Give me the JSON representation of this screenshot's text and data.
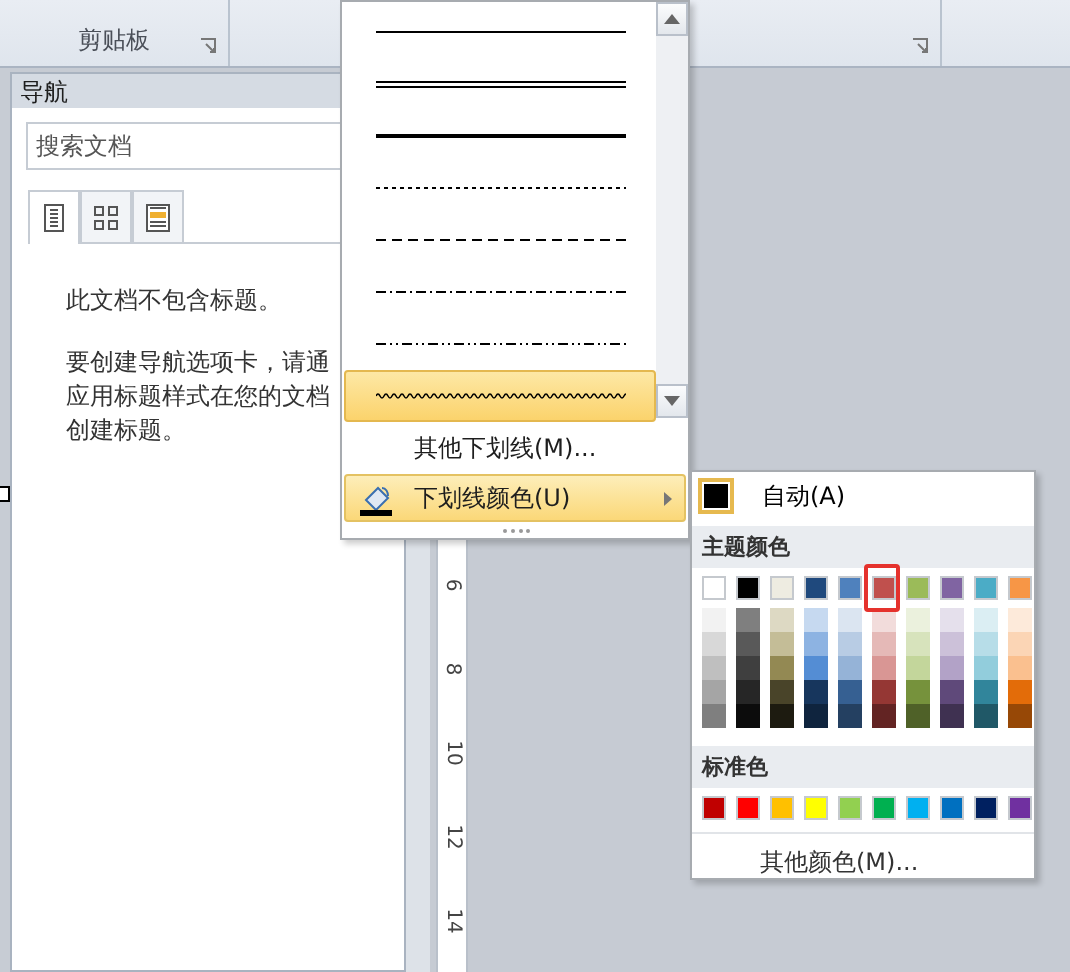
{
  "ribbon": {
    "groups": [
      {
        "label": "剪贴板"
      }
    ]
  },
  "navigation": {
    "title": "导航",
    "search": {
      "placeholder": "搜索文档"
    },
    "tabs": [
      {
        "kind": "headings",
        "selected": true
      },
      {
        "kind": "pages",
        "selected": false
      },
      {
        "kind": "results",
        "selected": false
      }
    ],
    "messages": [
      {
        "lines": [
          "此文档不包含标题。"
        ]
      },
      {
        "lines": [
          "要创建导航选项卡，请通",
          "应用标题样式在您的文档",
          "创建标题。"
        ]
      }
    ]
  },
  "ruler": {
    "labels": [
      "6",
      "8",
      "10",
      "12",
      "14"
    ]
  },
  "underline_menu": {
    "styles": [
      {
        "kind": "single",
        "selected": false
      },
      {
        "kind": "double",
        "selected": false
      },
      {
        "kind": "thick",
        "selected": false
      },
      {
        "kind": "dotted",
        "selected": false
      },
      {
        "kind": "dashed",
        "selected": false
      },
      {
        "kind": "dash-dot",
        "selected": false
      },
      {
        "kind": "dash-dot-dot",
        "selected": false
      },
      {
        "kind": "wavy",
        "selected": true
      }
    ],
    "items": [
      {
        "label": "其他下划线(M)...",
        "selected": false,
        "submenu": false
      },
      {
        "label": "下划线颜色(U)",
        "selected": true,
        "submenu": true
      }
    ]
  },
  "color_menu": {
    "automatic": {
      "label": "自动(A)",
      "color": "#000000"
    },
    "theme_title": "主题颜色",
    "theme_colors": [
      {
        "color": "#ffffff",
        "highlighted": false,
        "shades": [
          {
            "color": "#f2f2f2"
          },
          {
            "color": "#d8d8d8"
          },
          {
            "color": "#bfbfbf"
          },
          {
            "color": "#a5a5a5"
          },
          {
            "color": "#7f7f7f"
          }
        ]
      },
      {
        "color": "#000000",
        "highlighted": false,
        "shades": [
          {
            "color": "#7f7f7f"
          },
          {
            "color": "#595959"
          },
          {
            "color": "#3f3f3f"
          },
          {
            "color": "#262626"
          },
          {
            "color": "#0c0c0c"
          }
        ]
      },
      {
        "color": "#eeece1",
        "highlighted": false,
        "shades": [
          {
            "color": "#ddd9c3"
          },
          {
            "color": "#c4bd97"
          },
          {
            "color": "#938953"
          },
          {
            "color": "#494429"
          },
          {
            "color": "#1d1b10"
          }
        ]
      },
      {
        "color": "#1f497d",
        "highlighted": false,
        "shades": [
          {
            "color": "#c6d9f0"
          },
          {
            "color": "#8db3e2"
          },
          {
            "color": "#548dd4"
          },
          {
            "color": "#17365d"
          },
          {
            "color": "#0f243e"
          }
        ]
      },
      {
        "color": "#4f81bd",
        "highlighted": false,
        "shades": [
          {
            "color": "#dbe5f1"
          },
          {
            "color": "#b8cce4"
          },
          {
            "color": "#95b3d7"
          },
          {
            "color": "#366092"
          },
          {
            "color": "#244061"
          }
        ]
      },
      {
        "color": "#c0504d",
        "highlighted": true,
        "shades": [
          {
            "color": "#f2dcdb"
          },
          {
            "color": "#e5b9b7"
          },
          {
            "color": "#d99694"
          },
          {
            "color": "#953734"
          },
          {
            "color": "#632423"
          }
        ]
      },
      {
        "color": "#9bbb59",
        "highlighted": false,
        "shades": [
          {
            "color": "#ebf1dd"
          },
          {
            "color": "#d7e3bc"
          },
          {
            "color": "#c3d69b"
          },
          {
            "color": "#76923c"
          },
          {
            "color": "#4f6128"
          }
        ]
      },
      {
        "color": "#8064a2",
        "highlighted": false,
        "shades": [
          {
            "color": "#e5e0ec"
          },
          {
            "color": "#ccc1d9"
          },
          {
            "color": "#b2a2c7"
          },
          {
            "color": "#5f497a"
          },
          {
            "color": "#3f3151"
          }
        ]
      },
      {
        "color": "#4bacc6",
        "highlighted": false,
        "shades": [
          {
            "color": "#dbeef3"
          },
          {
            "color": "#b7dde8"
          },
          {
            "color": "#92cddc"
          },
          {
            "color": "#31859b"
          },
          {
            "color": "#205867"
          }
        ]
      },
      {
        "color": "#f79646",
        "highlighted": false,
        "shades": [
          {
            "color": "#fdeada"
          },
          {
            "color": "#fbd5b5"
          },
          {
            "color": "#fac08f"
          },
          {
            "color": "#e36c09"
          },
          {
            "color": "#974806"
          }
        ]
      }
    ],
    "standard_title": "标准色",
    "standard_colors": [
      {
        "color": "#c00000"
      },
      {
        "color": "#ff0000"
      },
      {
        "color": "#ffc000"
      },
      {
        "color": "#ffff00"
      },
      {
        "color": "#92d050"
      },
      {
        "color": "#00b050"
      },
      {
        "color": "#00b0f0"
      },
      {
        "color": "#0070c0"
      },
      {
        "color": "#002060"
      },
      {
        "color": "#7030a0"
      }
    ],
    "more_label": "其他颜色(M)..."
  }
}
